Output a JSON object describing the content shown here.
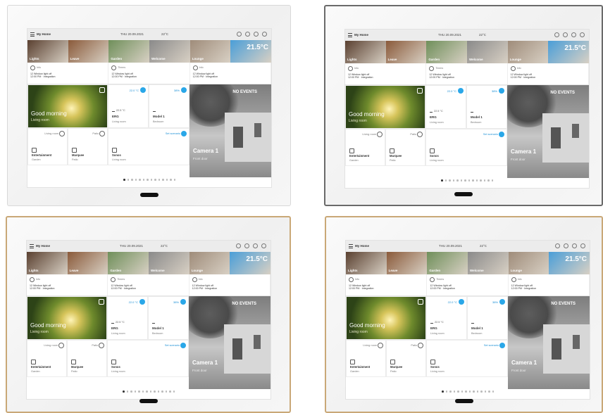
{
  "colors": {
    "accent": "#2aa7e8",
    "frame_white": "#d8d8d8",
    "frame_dark": "#6a6a6a",
    "frame_gold": "#c9a877"
  },
  "topbar": {
    "title": "My Home",
    "date": "THU 20.09.2021",
    "temp": "22°C"
  },
  "scenes": [
    {
      "label": "Lights",
      "bg": "#5a4030"
    },
    {
      "label": "Leave",
      "bg": "#8a5a3a"
    },
    {
      "label": "Garden",
      "bg": "#6f8f5a"
    },
    {
      "label": "Welcome",
      "bg": "#8a8a8a"
    },
    {
      "label": "Lounge",
      "bg": "#9f8c7a"
    },
    {
      "label": "",
      "bg": "#4a9ed8",
      "temp": "21.5°C"
    }
  ],
  "status": [
    {
      "icon": "bell-icon",
      "label": "Info",
      "line1": "12 Window light off",
      "line2": "12:00 PM · Integration"
    },
    {
      "icon": "clock-icon",
      "label": "Timers",
      "line1": "12 Window light off",
      "line2": "12:00 PM · Integration"
    },
    {
      "icon": "bell-icon",
      "label": "Info",
      "line1": "12 Window light off",
      "line2": "12:00 PM · Integration"
    }
  ],
  "greeting": {
    "title": "Good morning",
    "subtitle": "Living room"
  },
  "thermo": {
    "value": "22.0 °C",
    "small": "22.5 °C",
    "name": "ERG",
    "sub": "Living room"
  },
  "shutter": {
    "value": "38%",
    "name": "Model 1",
    "sub": "Bedroom"
  },
  "bottom": [
    {
      "top": "Living room",
      "name": "Entertainment",
      "sub": "Garden"
    },
    {
      "top": "Patio",
      "name": "Marquee",
      "sub": "Patio"
    },
    {
      "top": "Set scenario",
      "name": "Sonos",
      "sub": "Living room"
    }
  ],
  "camera": {
    "events": "NO EVENTS",
    "name": "Camera 1",
    "sub": "Front door"
  },
  "pager": {
    "pages": 14,
    "active": 0
  }
}
